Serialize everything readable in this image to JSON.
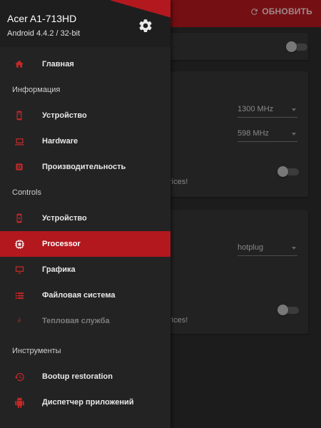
{
  "appbar": {
    "refresh_label": "ОБНОВИТЬ",
    "accent_color": "#b3181f"
  },
  "background": {
    "spinner_max_freq": "1300 MHz",
    "spinner_min_freq": "598 MHz",
    "governor_value": "hotplug",
    "partial_text_1": "rices!",
    "partial_text_2": "rices!"
  },
  "drawer": {
    "device_name": "Acer A1-713HD",
    "device_info": "Android 4.4.2 / 32-bit",
    "home_label": "Главная",
    "sections": {
      "info": "Информация",
      "controls": "Controls",
      "tools": "Инструменты"
    },
    "info_items": [
      "Устройство",
      "Hardware",
      "Производительность"
    ],
    "control_items": [
      "Устройство",
      "Processor",
      "Графика",
      "Файловая система",
      "Тепловая служба"
    ],
    "tool_items": [
      "Bootup restoration",
      "Диспетчер приложений"
    ],
    "active_item": "Processor"
  }
}
